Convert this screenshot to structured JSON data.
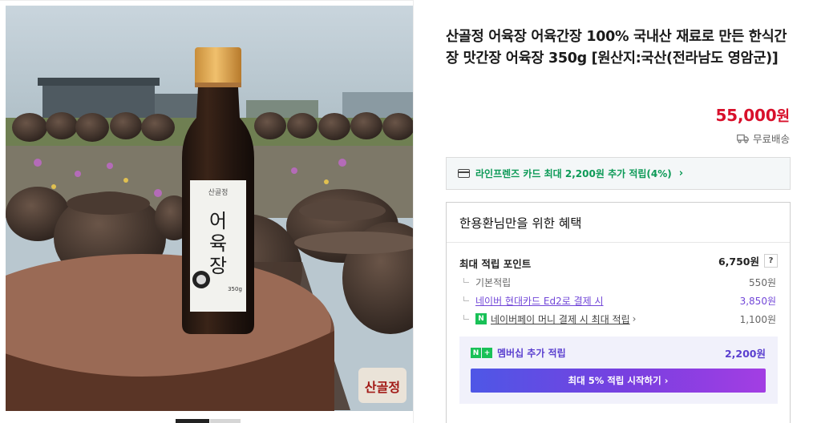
{
  "product": {
    "title": "산골정 어육장 어육간장 100% 국내산 재료로 만든 한식간장 맛간장 어육장 350g [원산지:국산(전라남도 영암군)]",
    "price_amount": "55,000",
    "price_unit": "원",
    "shipping": "무료배송",
    "bottle_brand": "산골정",
    "bottle_name": "어육장",
    "bottle_size": "350g",
    "watermark": "산골정"
  },
  "card_promo": {
    "text": "라인프렌즈 카드 최대 2,200원 추가 적립(4%)",
    "chevron": "›"
  },
  "benefits": {
    "title": "한용환님만을 위한 혜택",
    "max_points_label": "최대 적립 포인트",
    "max_points_value": "6,750원",
    "help": "?",
    "rows": [
      {
        "label": "기본적립",
        "value": "550원"
      },
      {
        "label": "네이버 현대카드 Ed2로 결제 시",
        "value": "3,850원"
      },
      {
        "label": "네이버페이 머니 결제 시 최대 적립",
        "value": "1,100원",
        "chevron": "›"
      }
    ],
    "membership_label": "멤버십 추가 적립",
    "membership_value": "2,200원",
    "start_button": "최대 5% 적립 시작하기",
    "start_chevron": "›"
  },
  "icons": {
    "truck": "truck-icon",
    "card": "credit-card-icon",
    "npay": "naver-pay-icon",
    "nplus": "naver-plus-icon"
  },
  "colors": {
    "price": "#d8102b",
    "promo_green": "#0d9a57",
    "membership_purple": "#5a3fcf",
    "button_gradient_start": "#4e57e6",
    "button_gradient_end": "#a33ee3"
  }
}
